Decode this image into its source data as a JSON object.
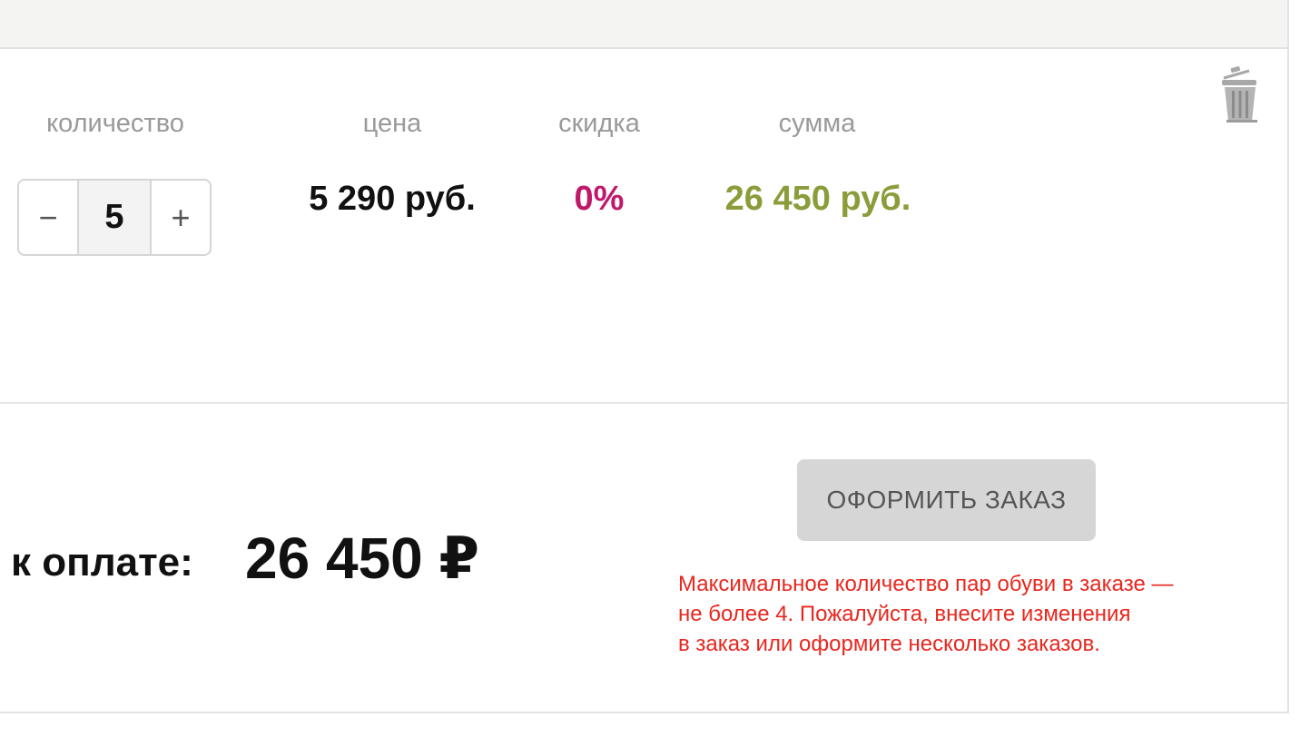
{
  "cart_item": {
    "headers": {
      "quantity": "количество",
      "price": "цена",
      "discount": "скидка",
      "sum": "сумма"
    },
    "stepper": {
      "minus": "−",
      "value": "5",
      "plus": "+"
    },
    "price": "5 290 руб.",
    "discount": "0%",
    "sum": "26 450 руб.",
    "delete_icon": "trash-icon"
  },
  "summary": {
    "total_label": "к оплате:",
    "total_value": "26 450 ₽",
    "order_button": "ОФОРМИТЬ ЗАКАЗ",
    "warning_lines": [
      "Максимальное количество пар обуви в заказе —",
      "не более 4. Пожалуйста, внесите изменения",
      "в заказ или оформите несколько заказов."
    ]
  },
  "colors": {
    "discount": "#c0186a",
    "sum": "#8a9d3a",
    "warning": "#e8271e",
    "button_bg": "#d6d6d6"
  }
}
